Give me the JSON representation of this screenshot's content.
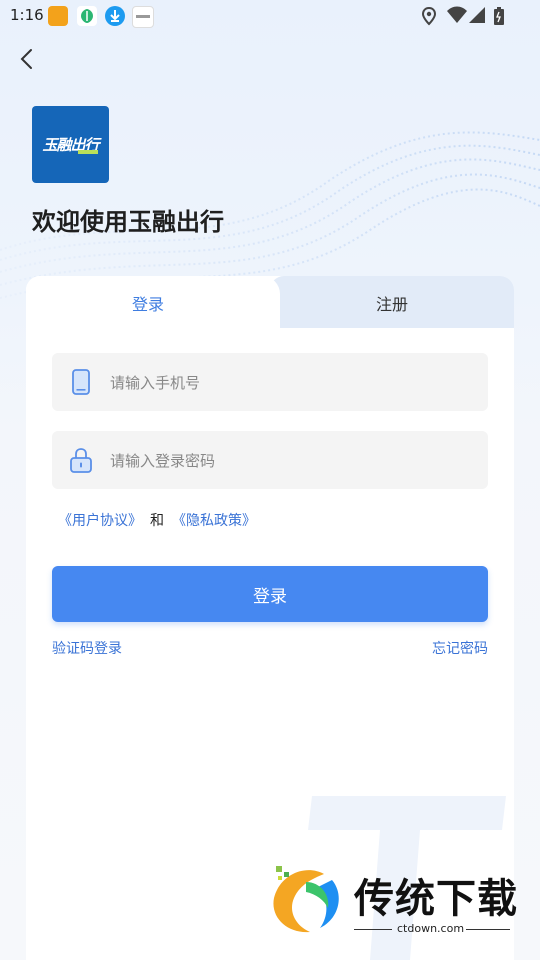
{
  "status_bar": {
    "time": "1:16",
    "icons": [
      "location-icon",
      "wifi-icon",
      "signal-icon",
      "battery-icon"
    ]
  },
  "app": {
    "logo_text": "玉融出行",
    "welcome": "欢迎使用玉融出行"
  },
  "tabs": {
    "login": "登录",
    "register": "注册"
  },
  "form": {
    "phone_placeholder": "请输入手机号",
    "password_placeholder": "请输入登录密码"
  },
  "agreement": {
    "user_agreement": "《用户协议》",
    "and": "和",
    "privacy_policy": "《隐私政策》"
  },
  "buttons": {
    "login": "登录",
    "sms_login": "验证码登录",
    "forgot_password": "忘记密码"
  },
  "watermark": {
    "title": "传统下载",
    "url": "ctdown.com"
  },
  "colors": {
    "accent": "#4688f1",
    "link": "#3a73d6",
    "tab_active_text": "#3f7de0",
    "field_bg": "#f4f4f4"
  }
}
